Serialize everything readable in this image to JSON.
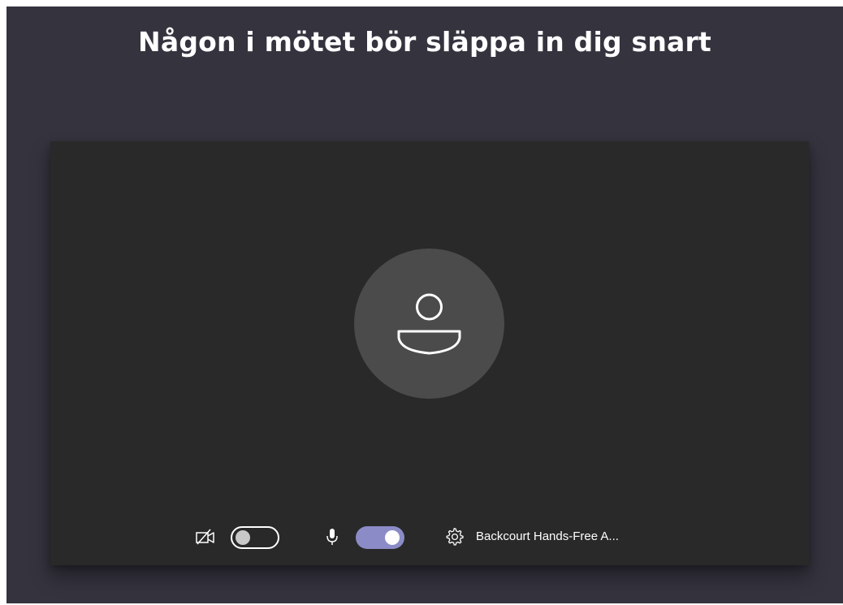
{
  "header": {
    "title": "Någon i mötet bör släppa in dig snart"
  },
  "preview": {
    "avatar_icon": "person-icon"
  },
  "controls": {
    "camera": {
      "icon": "camera-off-icon",
      "enabled": false
    },
    "microphone": {
      "icon": "microphone-icon",
      "enabled": true
    },
    "device_settings": {
      "icon": "gear-icon",
      "label": "Backcourt Hands-Free A..."
    }
  },
  "colors": {
    "background": "#34333e",
    "video_panel": "#292929",
    "avatar": "#4b4b4b",
    "toggle_on": "#8b8cc7",
    "text": "#ffffff"
  }
}
